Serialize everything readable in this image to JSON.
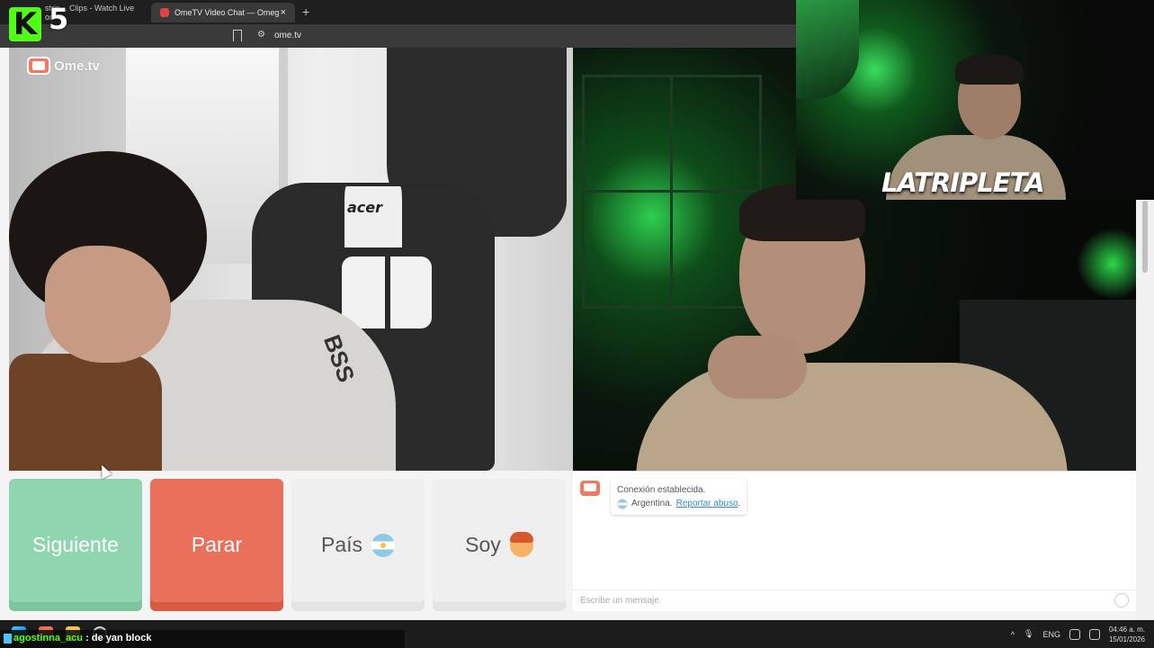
{
  "browser": {
    "tabs": [
      {
        "title": "strip... Clips - Watch Live on"
      },
      {
        "title": "OmeTV Video Chat — Omeg"
      }
    ],
    "url": "ome.tv",
    "new_tab_symbol": "+",
    "close_symbol": "×"
  },
  "stream_overlay": {
    "kick_letter": "K",
    "kick_number": "5",
    "brand_name": "LATRIPLETA"
  },
  "site": {
    "logo_text": "Ome.tv"
  },
  "left_video": {
    "chair_brand": "acer",
    "shirt_text": "BSS"
  },
  "buttons": {
    "next_label": "Siguiente",
    "stop_label": "Parar",
    "country_label": "País",
    "gender_label": "Soy"
  },
  "chat": {
    "status_line": "Conexión establecida.",
    "country": "Argentina.",
    "report_link": "Reportar abuso",
    "report_suffix": ".",
    "input_placeholder": "Escribe un mensaje"
  },
  "ticker": {
    "username": "agostinna_acu",
    "separator": " : ",
    "message": "de yan block"
  },
  "taskbar": {
    "language": "ENG",
    "time": "04:46 a. m.",
    "date": "15/01/2026",
    "tray_arrow": "^"
  },
  "icons": [
    "bookmark-icon",
    "site-settings-icon",
    "chat-ometv-icon",
    "emoji-icon",
    "windows-start-icon",
    "microphone-icon",
    "volume-icon",
    "wifi-icon",
    "argentina-flag-icon",
    "boy-emoji-icon"
  ],
  "colors": {
    "next_button": "#8fd6b0",
    "stop_button": "#e9705a",
    "kick_green": "#53fc18",
    "link": "#3a8bb5"
  }
}
